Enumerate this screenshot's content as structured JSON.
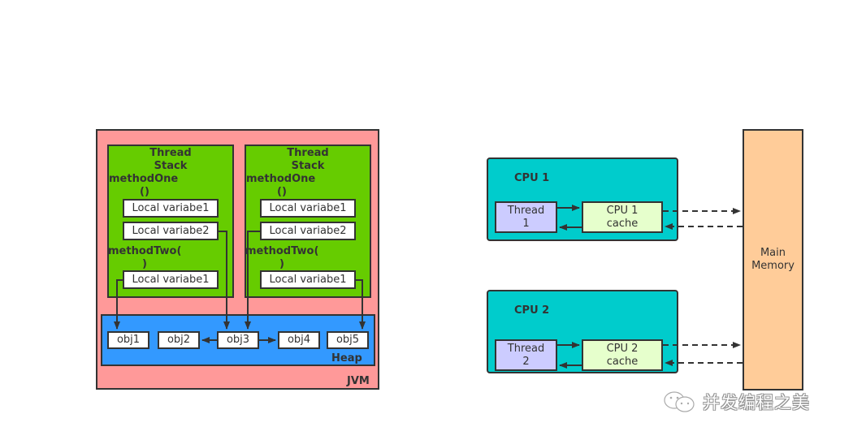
{
  "jvm": {
    "label": "JVM",
    "thread_stacks": [
      {
        "title_line1": "Thread",
        "title_line2": "Stack",
        "method_one_line1": "methodOne",
        "method_one_line2": "()",
        "method_one_vars": [
          "Local variabe1",
          "Local variabe2"
        ],
        "method_two_line1": "methodTwo(",
        "method_two_line2": ")",
        "method_two_vars": [
          "Local variabe1"
        ]
      },
      {
        "title_line1": "Thread",
        "title_line2": "Stack",
        "method_one_line1": "methodOne",
        "method_one_line2": "()",
        "method_one_vars": [
          "Local variabe1",
          "Local variabe2"
        ],
        "method_two_line1": "methodTwo(",
        "method_two_line2": ")",
        "method_two_vars": [
          "Local variabe1"
        ]
      }
    ],
    "heap": {
      "label": "Heap",
      "objects": [
        "obj1",
        "obj2",
        "obj3",
        "obj4",
        "obj5"
      ]
    },
    "references": [
      {
        "from": "stack1.methodTwo.var1",
        "to": "obj1"
      },
      {
        "from": "stack1.methodOne.var2",
        "to": "obj3"
      },
      {
        "from": "stack2.methodOne.var2",
        "to": "obj3"
      },
      {
        "from": "stack2.methodTwo.var1",
        "to": "obj5"
      },
      {
        "from": "obj3",
        "to": "obj2"
      },
      {
        "from": "obj3",
        "to": "obj4"
      }
    ]
  },
  "hardware": {
    "cpus": [
      {
        "title": "CPU 1",
        "thread_line1": "Thread",
        "thread_line2": "1",
        "cache_line1": "CPU 1",
        "cache_line2": "cache"
      },
      {
        "title": "CPU 2",
        "thread_line1": "Thread",
        "thread_line2": "2",
        "cache_line1": "CPU 2",
        "cache_line2": "cache"
      }
    ],
    "main_memory_line1": "Main",
    "main_memory_line2": "Memory"
  },
  "watermark": {
    "text": "并发编程之美",
    "icon": "wechat-icon"
  },
  "colors": {
    "jvm": "#ff9999",
    "thread_stack": "#66cc00",
    "heap": "#3399ff",
    "cpu": "#00cccc",
    "thread": "#ccccff",
    "cache": "#e6ffcc",
    "main_memory": "#ffcc99",
    "stroke": "#333333"
  }
}
